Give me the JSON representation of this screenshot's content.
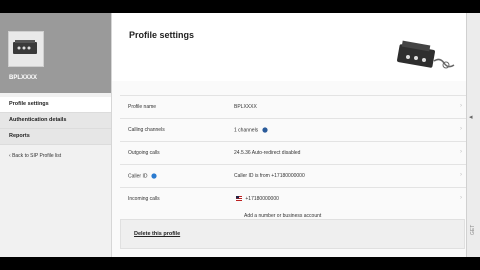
{
  "sidebar": {
    "profile_name": "BPLXXXX",
    "items": [
      {
        "label": "Profile settings"
      },
      {
        "label": "Authentication details"
      },
      {
        "label": "Reports"
      }
    ],
    "back_link": "Back to SIP Profile list"
  },
  "main": {
    "title": "Profile settings",
    "rows": [
      {
        "label": "Profile name",
        "value": "BPLXXXX"
      },
      {
        "label": "Calling channels",
        "value": "1 channels"
      },
      {
        "label": "Outgoing calls",
        "value": "24.5.36 Auto-redirect disabled"
      },
      {
        "label": "Caller ID",
        "value": "Caller ID is from +17180000000"
      },
      {
        "label": "Incoming calls",
        "value": "+17180000000"
      }
    ],
    "add_number_text": "Add a number or business account",
    "delete_link": "Delete this profile"
  },
  "scrollbar": {
    "side_text": "GET"
  },
  "colors": {
    "sidebar_header": "#9a9a9a",
    "background": "#ffffff"
  }
}
